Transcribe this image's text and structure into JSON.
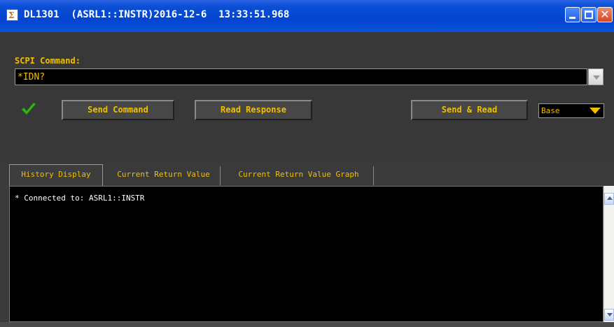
{
  "window": {
    "title": "DL1301  (ASRL1::INSTR)2016-12-6  13:33:51.968",
    "app_icon": "sigma-icon",
    "controls": [
      "minimize-icon",
      "maximize-icon",
      "close-icon"
    ]
  },
  "command": {
    "label": "SCPI Command:",
    "value": "*IDN?"
  },
  "status": {
    "icon": "checkmark-icon",
    "color": "#3cb41e"
  },
  "buttons": {
    "send_command": "Send Command",
    "read_response": "Read Response",
    "send_and_read": "Send & Read"
  },
  "base_select": {
    "value": "Base"
  },
  "tabs": [
    {
      "label": "History Display",
      "active": true
    },
    {
      "label": "Current Return Value",
      "active": false
    },
    {
      "label": "Current Return Value Graph",
      "active": false
    }
  ],
  "history": {
    "text": "* Connected to: ASRL1::INSTR"
  },
  "colors": {
    "accent_text": "#f0c000",
    "titlebar": "#0345cf",
    "background": "#3b3b3b"
  }
}
